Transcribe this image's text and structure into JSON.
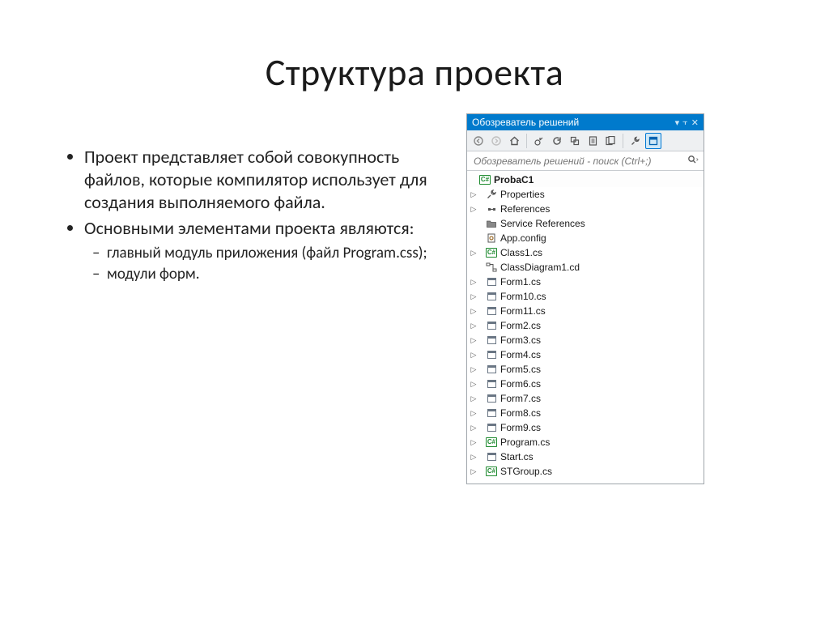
{
  "title": "Структура проекта",
  "bullets": {
    "b1": "Проект представляет собой совокупность файлов, которые компилятор использует для создания выполняемого файла.",
    "b2": "Основными элементами проекта являются:",
    "b2a": "главный модуль приложения (файл Program.css);",
    "b2b": " модули форм."
  },
  "panel": {
    "title": "Обозреватель решений",
    "search_placeholder": "Обозреватель решений - поиск (Ctrl+;)",
    "project": "ProbaC1",
    "items": [
      {
        "label": "Properties",
        "icon": "wrench",
        "expander": true
      },
      {
        "label": "References",
        "icon": "refs",
        "expander": true
      },
      {
        "label": "Service References",
        "icon": "folder",
        "expander": false
      },
      {
        "label": "App.config",
        "icon": "config",
        "expander": false
      },
      {
        "label": "Class1.cs",
        "icon": "cs",
        "expander": true
      },
      {
        "label": "ClassDiagram1.cd",
        "icon": "diagram",
        "expander": false
      },
      {
        "label": "Form1.cs",
        "icon": "form",
        "expander": true
      },
      {
        "label": "Form10.cs",
        "icon": "form",
        "expander": true
      },
      {
        "label": "Form11.cs",
        "icon": "form",
        "expander": true
      },
      {
        "label": "Form2.cs",
        "icon": "form",
        "expander": true
      },
      {
        "label": "Form3.cs",
        "icon": "form",
        "expander": true
      },
      {
        "label": "Form4.cs",
        "icon": "form",
        "expander": true
      },
      {
        "label": "Form5.cs",
        "icon": "form",
        "expander": true
      },
      {
        "label": "Form6.cs",
        "icon": "form",
        "expander": true
      },
      {
        "label": "Form7.cs",
        "icon": "form",
        "expander": true
      },
      {
        "label": "Form8.cs",
        "icon": "form",
        "expander": true
      },
      {
        "label": "Form9.cs",
        "icon": "form",
        "expander": true
      },
      {
        "label": "Program.cs",
        "icon": "cs",
        "expander": true
      },
      {
        "label": "Start.cs",
        "icon": "form",
        "expander": true
      },
      {
        "label": "STGroup.cs",
        "icon": "cs",
        "expander": true
      }
    ]
  }
}
